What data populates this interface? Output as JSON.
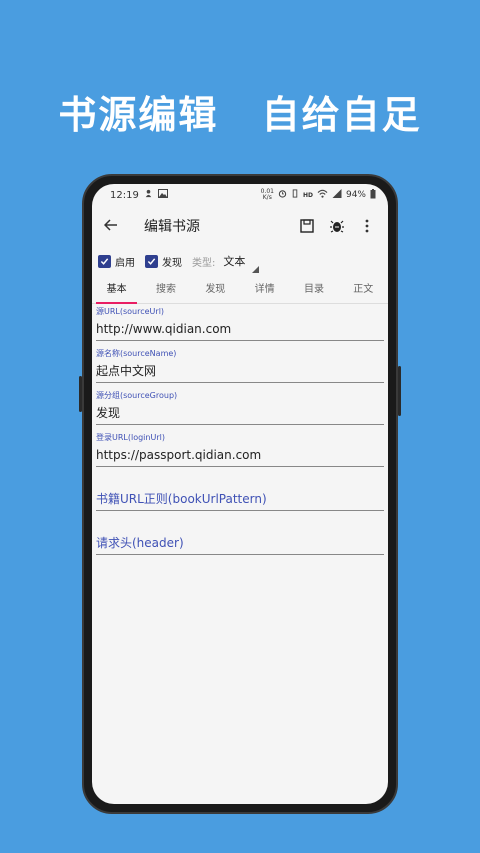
{
  "promo": {
    "title_left": "书源编辑",
    "title_right": "自给自足"
  },
  "status": {
    "time": "12:19",
    "net_speed": "0.01\nK/s",
    "battery": "94%"
  },
  "toolbar": {
    "title": "编辑书源"
  },
  "options": {
    "enable_label": "启用",
    "discover_label": "发现",
    "type_label": "类型:",
    "type_value": "文本"
  },
  "tabs": [
    "基本",
    "搜索",
    "发现",
    "详情",
    "目录",
    "正文"
  ],
  "fields": [
    {
      "label": "源URL(sourceUrl)",
      "value": "http://www.qidian.com"
    },
    {
      "label": "源名称(sourceName)",
      "value": "起点中文网"
    },
    {
      "label": "源分组(sourceGroup)",
      "value": "发现"
    },
    {
      "label": "登录URL(loginUrl)",
      "value": "https://passport.qidian.com"
    }
  ],
  "hints": [
    {
      "hint": "书籍URL正则(bookUrlPattern)"
    },
    {
      "hint": "请求头(header)"
    }
  ],
  "colors": {
    "background": "#4a9de0",
    "accent": "#3f51b5",
    "tab_indicator": "#e91e63",
    "checkbox": "#2f3f8f"
  }
}
